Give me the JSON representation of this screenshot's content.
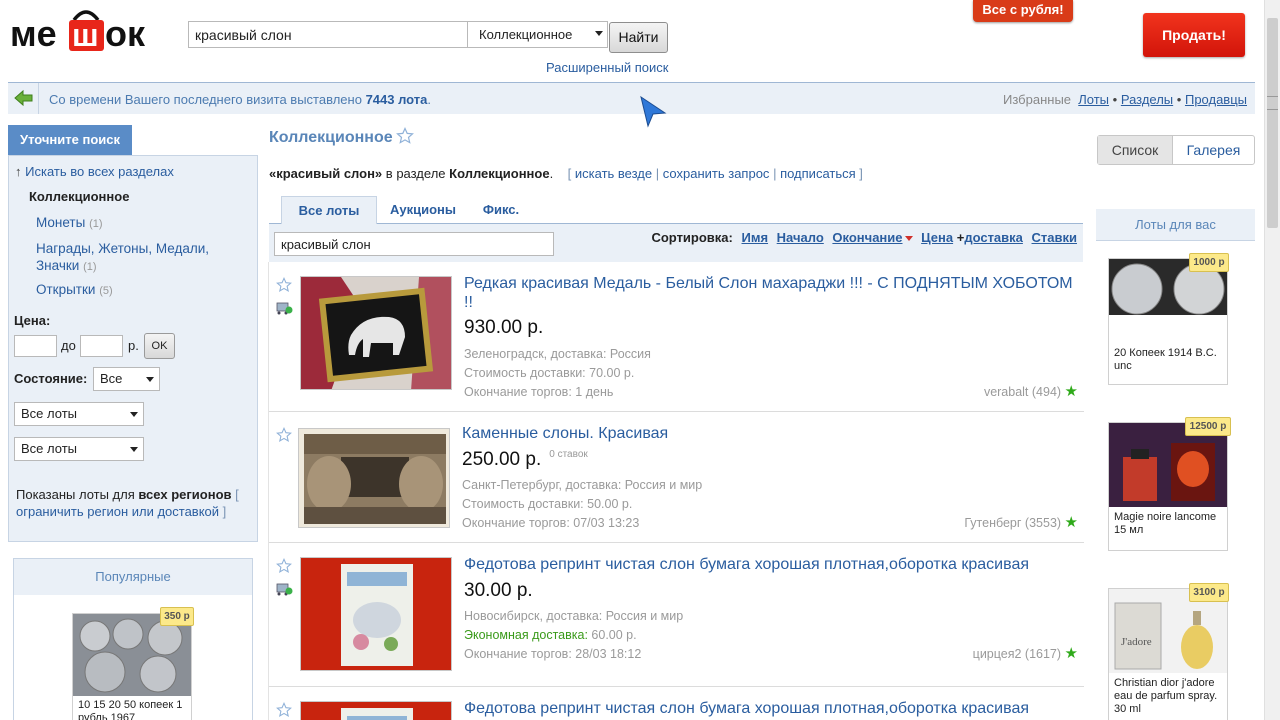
{
  "header": {
    "logo_text": "мешок",
    "search_value": "красивый слон",
    "category_selected": "Коллекционное",
    "find_label": "Найти",
    "advanced_search": "Расширенный поиск",
    "promo_label": "Все с рубля!",
    "sell_label": "Продать!"
  },
  "infobar": {
    "msg_prefix": "Со времени Вашего последнего визита выставлено",
    "msg_count": "7443 лота",
    "msg_suffix": ".",
    "favorites_label": "Избранные",
    "fav_lots": "Лоты",
    "fav_sections": "Разделы",
    "fav_sellers": "Продавцы",
    "bullet": "•"
  },
  "sidebar": {
    "refine_tab": "Уточните поиск",
    "search_all": "Искать во всех разделах",
    "category": "Коллекционное",
    "subcategories": [
      {
        "label": "Монеты",
        "count": "(1)"
      },
      {
        "label_line1": "Награды, Жетоны, Медали,",
        "label_line2": "Значки",
        "count": "(1)"
      },
      {
        "label": "Открытки",
        "count": "(5)"
      }
    ],
    "price_label": "Цена:",
    "price_to": "до",
    "price_currency": "р.",
    "ok_label": "OK",
    "condition_label": "Состояние:",
    "condition_value": "Все",
    "filter1_value": "Все лоты",
    "filter2_value": "Все лоты",
    "region_prefix": "Показаны лоты для",
    "region_bold_1": "всех",
    "region_bold_2": "регионов",
    "region_link": "ограничить регион или доставкой",
    "bracket_open": "[",
    "bracket_close": "]",
    "popular_title": "Популярные",
    "popular_item": {
      "price": "350 р",
      "caption_line1": "10 15 20 50 копеек 1",
      "caption_line2": "рубль 1967"
    }
  },
  "main": {
    "title": "Коллекционное",
    "query_prefix": "«красивый слон»",
    "query_in": "в разделе",
    "query_section": "Коллекционное",
    "query_dot": ".",
    "action_search_everywhere": "искать везде",
    "action_save": "сохранить запрос",
    "action_subscribe": "подписаться",
    "pipe": "|",
    "view_list": "Список",
    "view_gallery": "Галерея",
    "tabs": [
      "Все лоты",
      "Аукционы",
      "Фикс."
    ],
    "filter_value": "красивый слон",
    "sort_label": "Сортировка:",
    "sort_name": "Имя",
    "sort_start": "Начало",
    "sort_end": "Окончание",
    "sort_price": "Цена",
    "sort_plus": "+",
    "sort_delivery": "доставка",
    "sort_bids": "Ставки"
  },
  "lots": [
    {
      "title": "Редкая красивая Медаль - Белый Слон махараджи !!! - С ПОДНЯТЫМ ХОБОТОМ !!",
      "price": "930.00 р.",
      "bids": "",
      "location": "Зеленоградск, доставка: Россия",
      "shipping_label": "Стоимость доставки:",
      "shipping_value": "70.00 р.",
      "ends": "Окончание торгов: 1 день",
      "seller": "verabalt (494)"
    },
    {
      "title": "Каменные слоны. Красивая",
      "price": "250.00 р.",
      "bids": "0 ставок",
      "location": "Санкт-Петербург, доставка: Россия и мир",
      "shipping_label": "Стоимость доставки:",
      "shipping_value": "50.00 р.",
      "ends": "Окончание торгов: 07/03 13:23",
      "seller": "Гутенберг (3553)"
    },
    {
      "title": "Федотова репринт чистая слон бумага хорошая плотная,оборотка красивая",
      "price": "30.00 р.",
      "bids": "",
      "location": "Новосибирск, доставка: Россия и мир",
      "shipping_label": "Экономная доставка:",
      "shipping_value": "60.00 р.",
      "ends": "Окончание торгов: 28/03 18:12",
      "seller": "цирцея2 (1617)"
    },
    {
      "title": "Федотова репринт чистая слон бумага хорошая плотная,оборотка красивая"
    }
  ],
  "right": {
    "title": "Лоты для вас",
    "items": [
      {
        "price": "1000 р",
        "caption_line1": "20 Копеек 1914 B.C.",
        "caption_line2": "unc",
        "caption_line3": ""
      },
      {
        "price": "12500 р",
        "caption_line1": "Magie noire lancome",
        "caption_line2": "15 мл",
        "caption_line3": ""
      },
      {
        "price": "3100 р",
        "caption_line1": "Christian dior j'adore",
        "caption_line2": "eau de parfum spray.",
        "caption_line3": "30 ml"
      }
    ]
  },
  "colors": {
    "accent": "#2a5d9f",
    "sell": "#e8261a",
    "panel": "#eaf0f7",
    "seller_star": "#2faa1a"
  }
}
